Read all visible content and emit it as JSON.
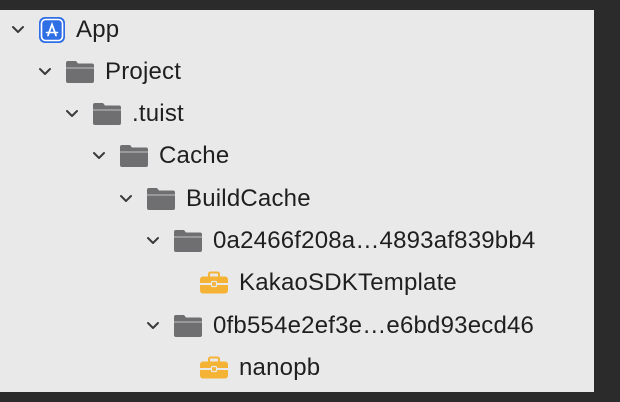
{
  "tree": {
    "items": [
      {
        "label": "App",
        "icon": "app-icon",
        "expanded": true
      },
      {
        "label": "Project",
        "icon": "folder-icon",
        "expanded": true
      },
      {
        "label": ".tuist",
        "icon": "folder-icon",
        "expanded": true
      },
      {
        "label": "Cache",
        "icon": "folder-icon",
        "expanded": true
      },
      {
        "label": "BuildCache",
        "icon": "folder-icon",
        "expanded": true
      },
      {
        "label": "0a2466f208a…4893af839bb4",
        "icon": "folder-icon",
        "expanded": true
      },
      {
        "label": "KakaoSDKTemplate",
        "icon": "toolbox-icon"
      },
      {
        "label": "0fb554e2ef3e…e6bd93ecd46",
        "icon": "folder-icon",
        "expanded": true
      },
      {
        "label": "nanopb",
        "icon": "toolbox-icon"
      }
    ]
  },
  "colors": {
    "panel_bg": "#e9e9e9",
    "outer_bg": "#2b2b2b",
    "folder": "#6f6f72",
    "app_blue": "#2f6fe6",
    "toolbox": "#f5b335",
    "text": "#1f1f1f"
  }
}
